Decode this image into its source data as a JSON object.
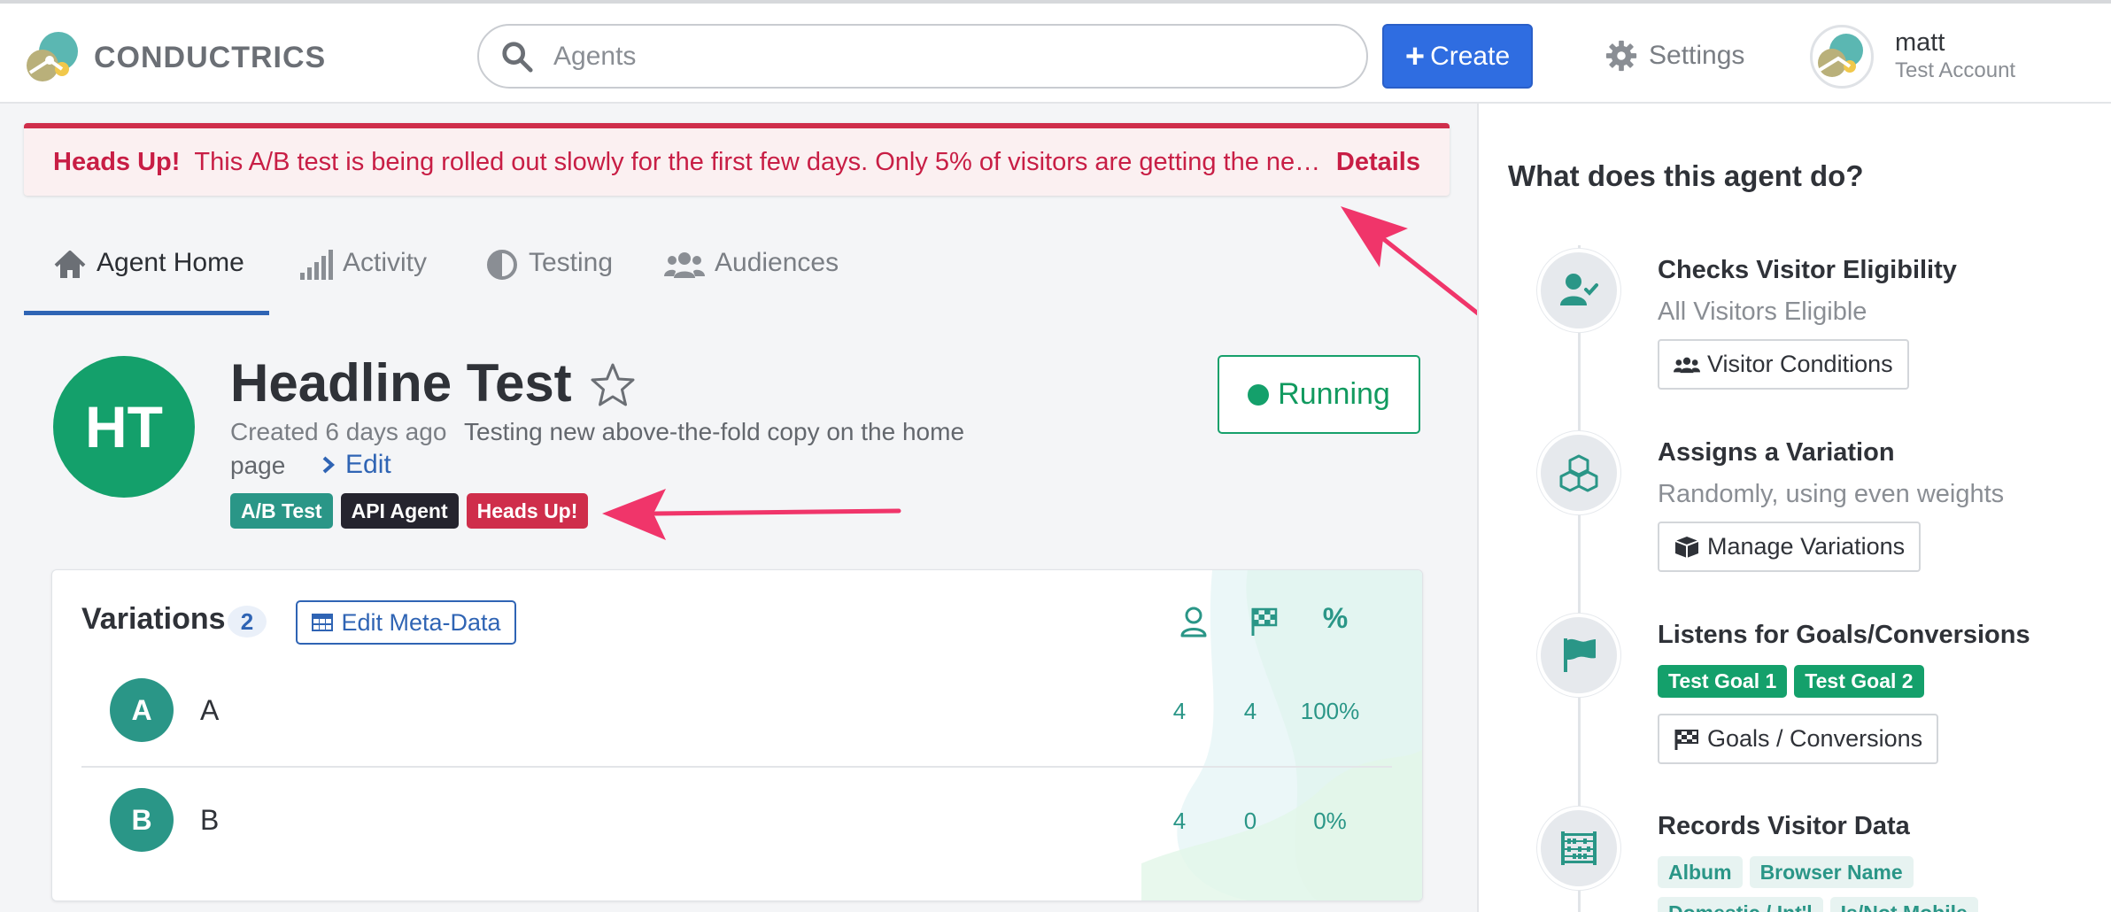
{
  "brand": {
    "name": "CONDUCTRICS"
  },
  "search": {
    "placeholder": "Agents",
    "value": ""
  },
  "header": {
    "create_label": "Create",
    "settings_label": "Settings",
    "user_name": "matt",
    "user_account": "Test Account"
  },
  "alert": {
    "title": "Heads Up!",
    "message": "This A/B test is being rolled out slowly for the first few days. Only 5% of visitors are getting the new experience until the rollout is complete.",
    "details_label": "Details"
  },
  "tabs": [
    {
      "label": "Agent Home",
      "icon": "home-icon",
      "active": true
    },
    {
      "label": "Activity",
      "icon": "bar-chart-icon",
      "active": false
    },
    {
      "label": "Testing",
      "icon": "half-circle-icon",
      "active": false
    },
    {
      "label": "Audiences",
      "icon": "users-icon",
      "active": false
    }
  ],
  "agent": {
    "initials": "HT",
    "title": "Headline Test",
    "created": "Created 6 days ago",
    "description_line1": "Testing new above-the-fold copy on the home",
    "description_line2": "page",
    "edit_label": "Edit",
    "status": "Running",
    "badges": [
      "A/B Test",
      "API Agent",
      "Heads Up!"
    ],
    "colors": {
      "avatar": "#14a06b",
      "ab_badge": "#2a9687",
      "api_badge": "#25242e",
      "heads_badge": "#cf2e4b"
    }
  },
  "variations": {
    "title": "Variations",
    "count": "2",
    "edit_meta_label": "Edit Meta-Data",
    "columns": [
      "visitors-icon",
      "goals-flag-icon",
      "percent-icon"
    ],
    "column_percent_label": "%",
    "rows": [
      {
        "letter": "A",
        "name": "A",
        "visitors": "4",
        "goals": "4",
        "percent": "100%"
      },
      {
        "letter": "B",
        "name": "B",
        "visitors": "4",
        "goals": "0",
        "percent": "0%"
      }
    ]
  },
  "side": {
    "title": "What does this agent do?",
    "steps": [
      {
        "title": "Checks Visitor Eligibility",
        "subtitle": "All Visitors Eligible",
        "button": "Visitor Conditions",
        "icon": "user-check-icon"
      },
      {
        "title": "Assigns a Variation",
        "subtitle": "Randomly, using even weights",
        "button": "Manage Variations",
        "icon": "cubes-icon"
      },
      {
        "title": "Listens for Goals/Conversions",
        "goals": [
          "Test Goal 1",
          "Test Goal 2"
        ],
        "button": "Goals / Conversions",
        "icon": "flag-icon"
      },
      {
        "title": "Records Visitor Data",
        "tags": [
          "Album",
          "Browser Name",
          "Domestic / Int'l",
          "Is/Not Mobile"
        ],
        "icon": "abacus-icon"
      }
    ]
  },
  "colors": {
    "accent": "#2f6de1",
    "alert": "#c81e45",
    "teal": "#2a9687",
    "green": "#14a06b",
    "arrow": "#f0356a"
  }
}
